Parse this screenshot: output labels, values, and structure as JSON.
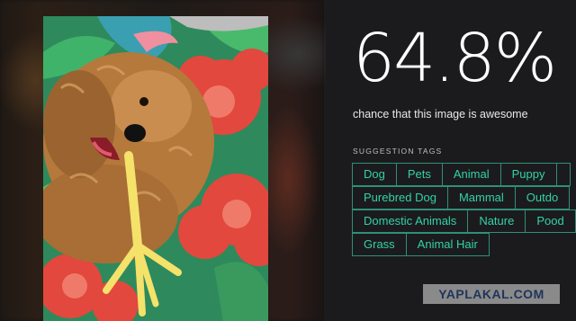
{
  "result": {
    "score": "64.8%",
    "caption": "chance that this image is awesome"
  },
  "suggestions": {
    "heading": "SUGGESTION TAGS",
    "rows": [
      [
        "Dog",
        "Pets",
        "Animal",
        "Puppy",
        ""
      ],
      [
        "Purebred Dog",
        "Mammal",
        "Outdo"
      ],
      [
        "Domestic Animals",
        "Nature",
        "Pood"
      ],
      [
        "Grass",
        "Animal Hair"
      ]
    ]
  },
  "watermark": "YAPLAKAL.COM",
  "photo": {
    "subject": "puppy-chewing-chicken-foot-on-hibiscus-blanket"
  },
  "colors": {
    "background": "#1b1b1d",
    "tag_text": "#33d2a8",
    "tag_border": "#2f8f78"
  }
}
